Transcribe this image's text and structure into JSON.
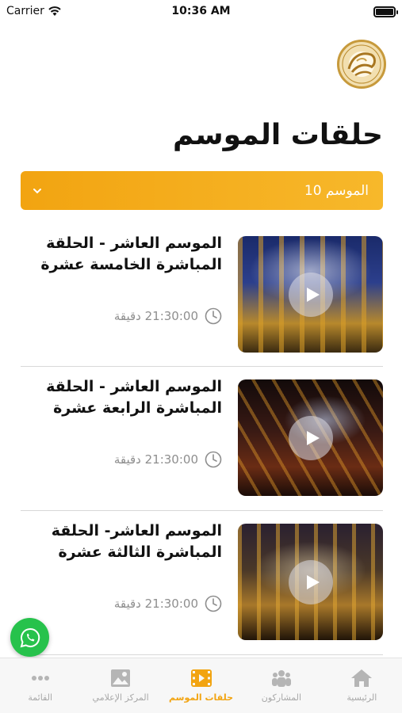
{
  "status_bar": {
    "carrier": "Carrier",
    "time": "10:36 AM"
  },
  "logo": {
    "icon": "shaer-logo"
  },
  "page_title": "حلقات الموسم",
  "season_select": {
    "value": "الموسم 10",
    "icon": "chevron-down-icon"
  },
  "episodes": [
    {
      "title": "الموسم العاشر - الحلقة المباشرة الخامسة عشرة",
      "duration": "21:30:00 دقيقة"
    },
    {
      "title": "الموسم العاشر - الحلقة المباشرة الرابعة عشرة",
      "duration": "21:30:00 دقيقة"
    },
    {
      "title": "الموسم العاشر- الحلقة المباشرة الثالثة عشرة",
      "duration": "21:30:00 دقيقة"
    }
  ],
  "tabs": [
    {
      "label": "الرئيسية",
      "icon": "home-icon",
      "active": false
    },
    {
      "label": "المشاركون",
      "icon": "people-icon",
      "active": false
    },
    {
      "label": "حلقات الموسم",
      "icon": "video-icon",
      "active": true
    },
    {
      "label": "المركز الإعلامي",
      "icon": "image-icon",
      "active": false
    },
    {
      "label": "القائمة",
      "icon": "more-icon",
      "active": false
    }
  ],
  "colors": {
    "accent": "#f2a411",
    "inactive": "#a8a8a8",
    "whatsapp": "#27c24c"
  }
}
